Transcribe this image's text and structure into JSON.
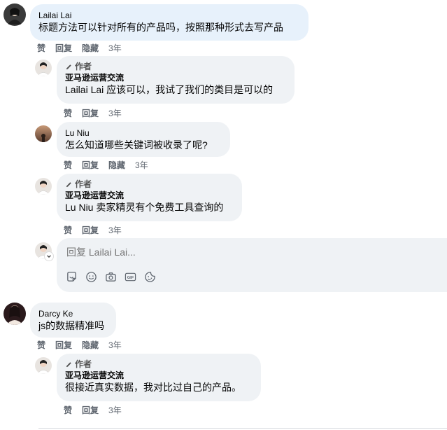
{
  "comments": [
    {
      "name": "Lailai Lai",
      "text": "标题方法可以针对所有的产品吗，按照那种形式去写产品",
      "actions": [
        "赞",
        "回复",
        "隐藏"
      ],
      "time": "3年"
    },
    {
      "author_tag": "作者",
      "name": "亚马逊运营交流",
      "mention": "Lailai Lai",
      "text": "应该可以，我试了我们的类目是可以的",
      "actions": [
        "赞",
        "回复"
      ],
      "time": "3年"
    },
    {
      "name": "Lu Niu",
      "text": "怎么知道哪些关键词被收录了呢?",
      "actions": [
        "赞",
        "回复",
        "隐藏"
      ],
      "time": "3年"
    },
    {
      "author_tag": "作者",
      "name": "亚马逊运营交流",
      "mention": "Lu Niu",
      "text": "卖家精灵有个免费工具查询的",
      "actions": [
        "赞",
        "回复"
      ],
      "time": "3年"
    },
    {
      "name": "Darcy Ke",
      "text": "js的数据精准吗",
      "actions": [
        "赞",
        "回复",
        "隐藏"
      ],
      "time": "3年"
    },
    {
      "author_tag": "作者",
      "name": "亚马逊运营交流",
      "text": "很接近真实数据，我对比过自己的产品。",
      "actions": [
        "赞",
        "回复"
      ],
      "time": "3年"
    }
  ],
  "reply": {
    "placeholder": "回复 Lailai Lai..."
  },
  "icons": [
    "sticker-icon",
    "emoji-icon",
    "camera-icon",
    "gif-icon",
    "sticker-face-icon"
  ],
  "colors": {
    "bubble": "#eff2f5",
    "highlight": "#e7f1fb",
    "meta": "#606770"
  }
}
